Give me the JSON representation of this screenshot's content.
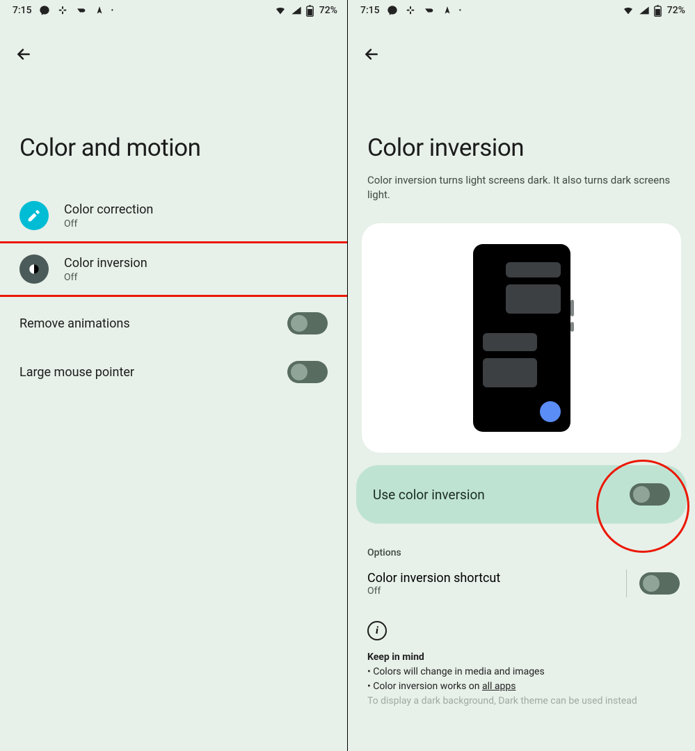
{
  "statusbar": {
    "time": "7:15",
    "battery_pct": "72%"
  },
  "left": {
    "title": "Color and motion",
    "color_correction": {
      "label": "Color correction",
      "status": "Off"
    },
    "color_inversion": {
      "label": "Color inversion",
      "status": "Off"
    },
    "remove_animations": {
      "label": "Remove animations"
    },
    "large_mouse": {
      "label": "Large mouse pointer"
    }
  },
  "right": {
    "title": "Color inversion",
    "subtitle": "Color inversion turns light screens dark. It also turns dark screens light.",
    "use_toggle": {
      "label": "Use color inversion"
    },
    "options_hdr": "Options",
    "shortcut": {
      "label": "Color inversion shortcut",
      "status": "Off"
    },
    "keep_hdr": "Keep in mind",
    "keep1": "Colors will change in media and images",
    "keep2a": "Color inversion works on ",
    "keep2b": "all apps",
    "keep3": "To display a dark background, Dark theme can be used instead"
  }
}
